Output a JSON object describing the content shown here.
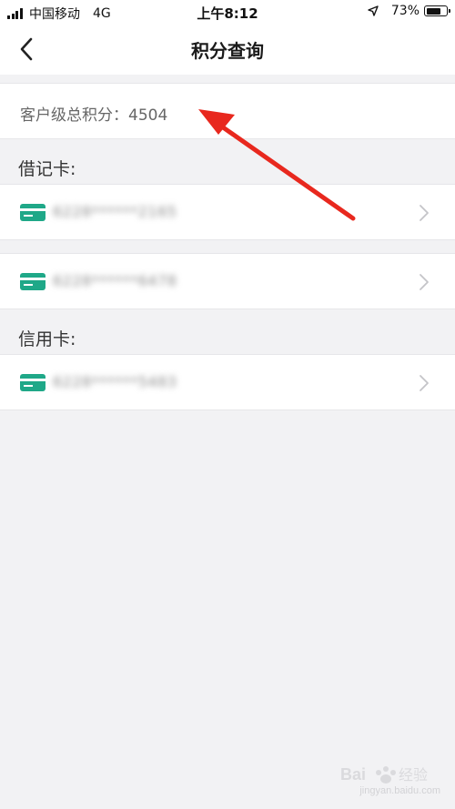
{
  "status_bar": {
    "carrier": "中国移动",
    "network": "4G",
    "time": "上午8:12",
    "battery_percent": "73%",
    "battery_level": 0.73,
    "icons": [
      "signal-icon",
      "location-arrow-icon",
      "battery-icon"
    ]
  },
  "nav": {
    "title": "积分查询",
    "back_icon": "chevron-left-icon"
  },
  "summary": {
    "text": "客户级总积分：4504"
  },
  "sections": {
    "debit_label": "借记卡:",
    "credit_label": "信用卡:"
  },
  "cards": {
    "debit": [
      {
        "number": "6228******2165"
      },
      {
        "number": "6228******6478"
      }
    ],
    "credit": [
      {
        "number": "6228******5483"
      }
    ],
    "icon": "bank-card-icon",
    "chevron_icon": "chevron-right-icon",
    "icon_color": "#1fa888"
  },
  "colors": {
    "annotation_arrow": "#e8281e",
    "background": "#f2f2f4"
  },
  "watermark": {
    "text": "jingyan.baidu.com"
  }
}
